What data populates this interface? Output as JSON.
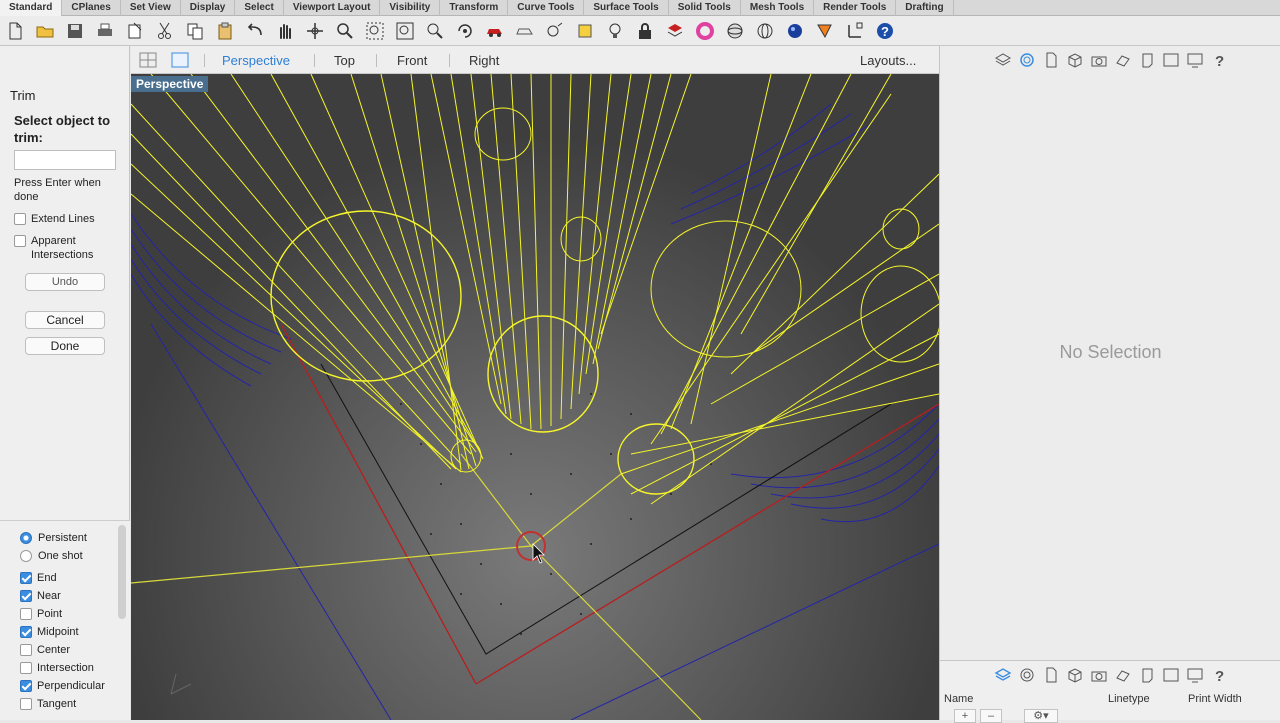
{
  "tabs": [
    "Standard",
    "CPlanes",
    "Set View",
    "Display",
    "Select",
    "Viewport Layout",
    "Visibility",
    "Transform",
    "Curve Tools",
    "Surface Tools",
    "Solid Tools",
    "Mesh Tools",
    "Render Tools",
    "Drafting"
  ],
  "active_tab": "Standard",
  "toolbar_icons": [
    "new-file-icon",
    "open-folder-icon",
    "save-icon",
    "print-icon",
    "paste-icon",
    "cut-icon",
    "copy-icon",
    "clipboard-icon",
    "undo-icon",
    "pan-hand-icon",
    "move-icon",
    "zoom-icon",
    "zoom-window-icon",
    "zoom-extents-icon",
    "zoom-selected-icon",
    "rotate-view-icon",
    "car-icon",
    "car-outline-icon",
    "snap-icon",
    "dim-icon",
    "bulb-icon",
    "lock-icon",
    "layer-icon",
    "color-wheel-icon",
    "sphere-icon",
    "wire-sphere-icon",
    "render-sphere-icon",
    "render-icon",
    "gumball-icon",
    "help-icon"
  ],
  "command": {
    "title": "Trim",
    "prompt": "Select object to trim:",
    "note": "Press Enter when done",
    "options": [
      {
        "label": "Extend Lines",
        "checked": false
      },
      {
        "label": "Apparent Intersections",
        "checked": false
      }
    ],
    "undo_label": "Undo",
    "cancel_label": "Cancel",
    "done_label": "Done"
  },
  "osnap": {
    "modes": [
      {
        "label": "Persistent",
        "on": true
      },
      {
        "label": "One shot",
        "on": false
      }
    ],
    "snaps": [
      {
        "label": "End",
        "checked": true
      },
      {
        "label": "Near",
        "checked": true
      },
      {
        "label": "Point",
        "checked": false
      },
      {
        "label": "Midpoint",
        "checked": true
      },
      {
        "label": "Center",
        "checked": false
      },
      {
        "label": "Intersection",
        "checked": false
      },
      {
        "label": "Perpendicular",
        "checked": true
      },
      {
        "label": "Tangent",
        "checked": false
      }
    ]
  },
  "viewbar": {
    "tabs": [
      "Perspective",
      "Top",
      "Front",
      "Right"
    ],
    "active": "Perspective",
    "layouts_label": "Layouts..."
  },
  "viewport": {
    "label": "Perspective"
  },
  "right_panel": {
    "status": "No Selection",
    "columns": [
      "Name",
      "Linetype",
      "Print Width"
    ],
    "add_label": "+",
    "remove_label": "–"
  }
}
